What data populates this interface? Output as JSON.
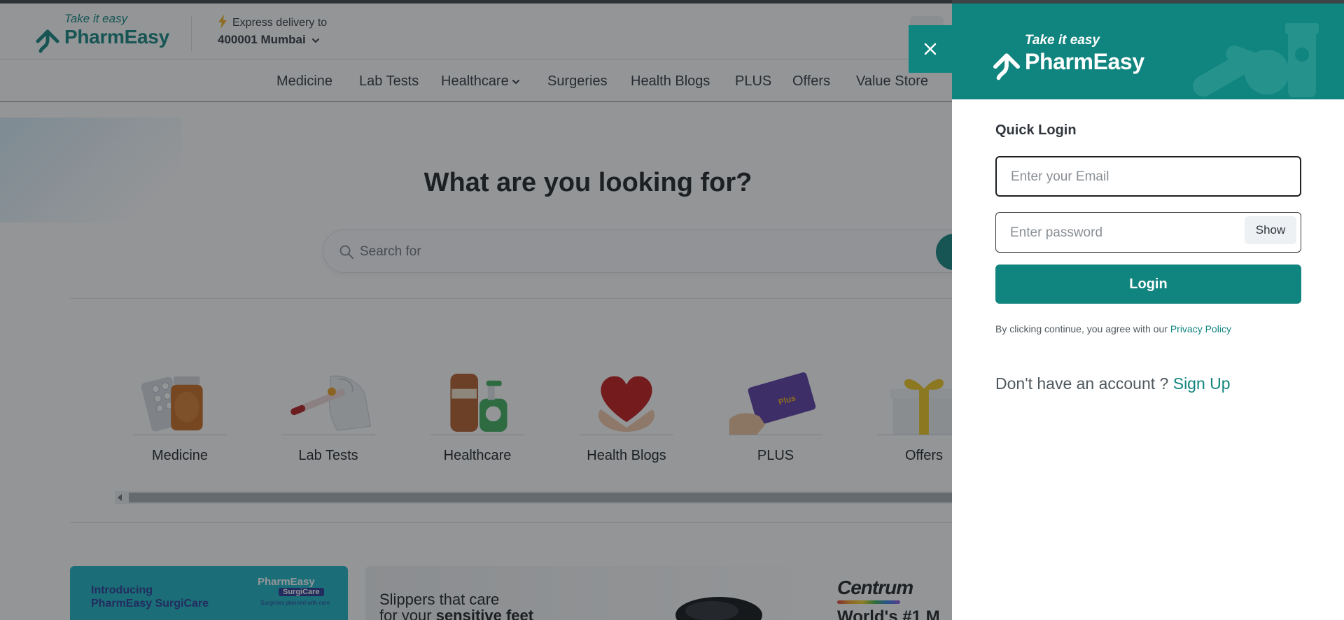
{
  "brand": {
    "tagline": "Take it easy",
    "name": "PharmEasy"
  },
  "header": {
    "delivery_label": "Express delivery to",
    "location": "400001 Mumbai"
  },
  "nav": {
    "items": [
      "Medicine",
      "Lab Tests",
      "Healthcare",
      "Surgeries",
      "Health Blogs",
      "PLUS",
      "Offers",
      "Value Store"
    ]
  },
  "hero": {
    "title": "What are you looking for?",
    "search_placeholder": "Search for"
  },
  "categories": [
    "Medicine",
    "Lab Tests",
    "Healthcare",
    "Health Blogs",
    "PLUS",
    "Offers"
  ],
  "banners": {
    "surgicare": {
      "line1": "Introducing",
      "line2": "PharmEasy SurgiCare",
      "logo_name": "PharmEasy",
      "logo_badge": "SurgiCare",
      "logo_sub": "Surgeries planned with care"
    },
    "slippers": {
      "line1": "Slippers that care",
      "line2_pre": "for your ",
      "line2_bold": "sensitive feet"
    },
    "centrum": {
      "brand": "Centrum",
      "headline": "World's #1 M"
    }
  },
  "login": {
    "title": "Quick Login",
    "email_placeholder": "Enter your Email",
    "password_placeholder": "Enter password",
    "show_label": "Show",
    "login_label": "Login",
    "terms_text": "By clicking continue, you agree with our ",
    "privacy_link": "Privacy Policy",
    "no_account_text": "Don't have an account ? ",
    "signup_link": "Sign Up"
  },
  "colors": {
    "brand_teal": "#10847e",
    "text_dark": "#30363c",
    "overlay": "rgba(30,34,38,0.48)"
  },
  "icons": {
    "close": "close-icon",
    "search": "search-icon",
    "bolt": "bolt-icon",
    "chevron": "chevron-down-icon"
  }
}
